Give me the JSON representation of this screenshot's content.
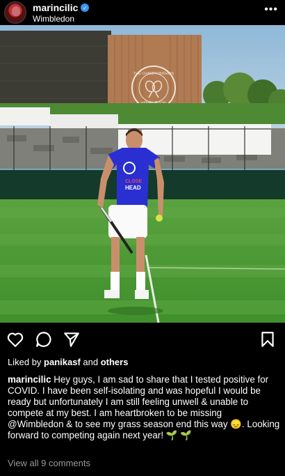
{
  "header": {
    "username": "marincilic",
    "location": "Wimbledon",
    "more_label": "•••"
  },
  "photo": {
    "sign_line1": "THE CHAMPIONSHIPS",
    "sign_line2": "WIMBLEDON",
    "shirt_text1": "CLOSE",
    "shirt_text2": "HEAD"
  },
  "actions": {
    "icons": [
      "heart-icon",
      "comment-icon",
      "share-icon",
      "bookmark-icon"
    ]
  },
  "likes": {
    "prefix": "Liked by ",
    "user": "panikasf",
    "middle": " and ",
    "others": "others"
  },
  "caption": {
    "username": "marincilic",
    "text": " Hey guys, I am sad to share that I tested positive for COVID. I have been self-isolating and was hopeful I would be ready but unfortunately I am still feeling unwell & unable to compete at my best. I am heartbroken to be missing @Wimbledon & to see my grass season end this way 😞. Looking forward to competing again next year! 🌱 🌱"
  },
  "comments": {
    "view_all": "View all 9 comments"
  },
  "colors": {
    "background": "#000000",
    "verified": "#3897f0",
    "grass": "#4f9a3a",
    "shirt": "#2a2fd1"
  }
}
